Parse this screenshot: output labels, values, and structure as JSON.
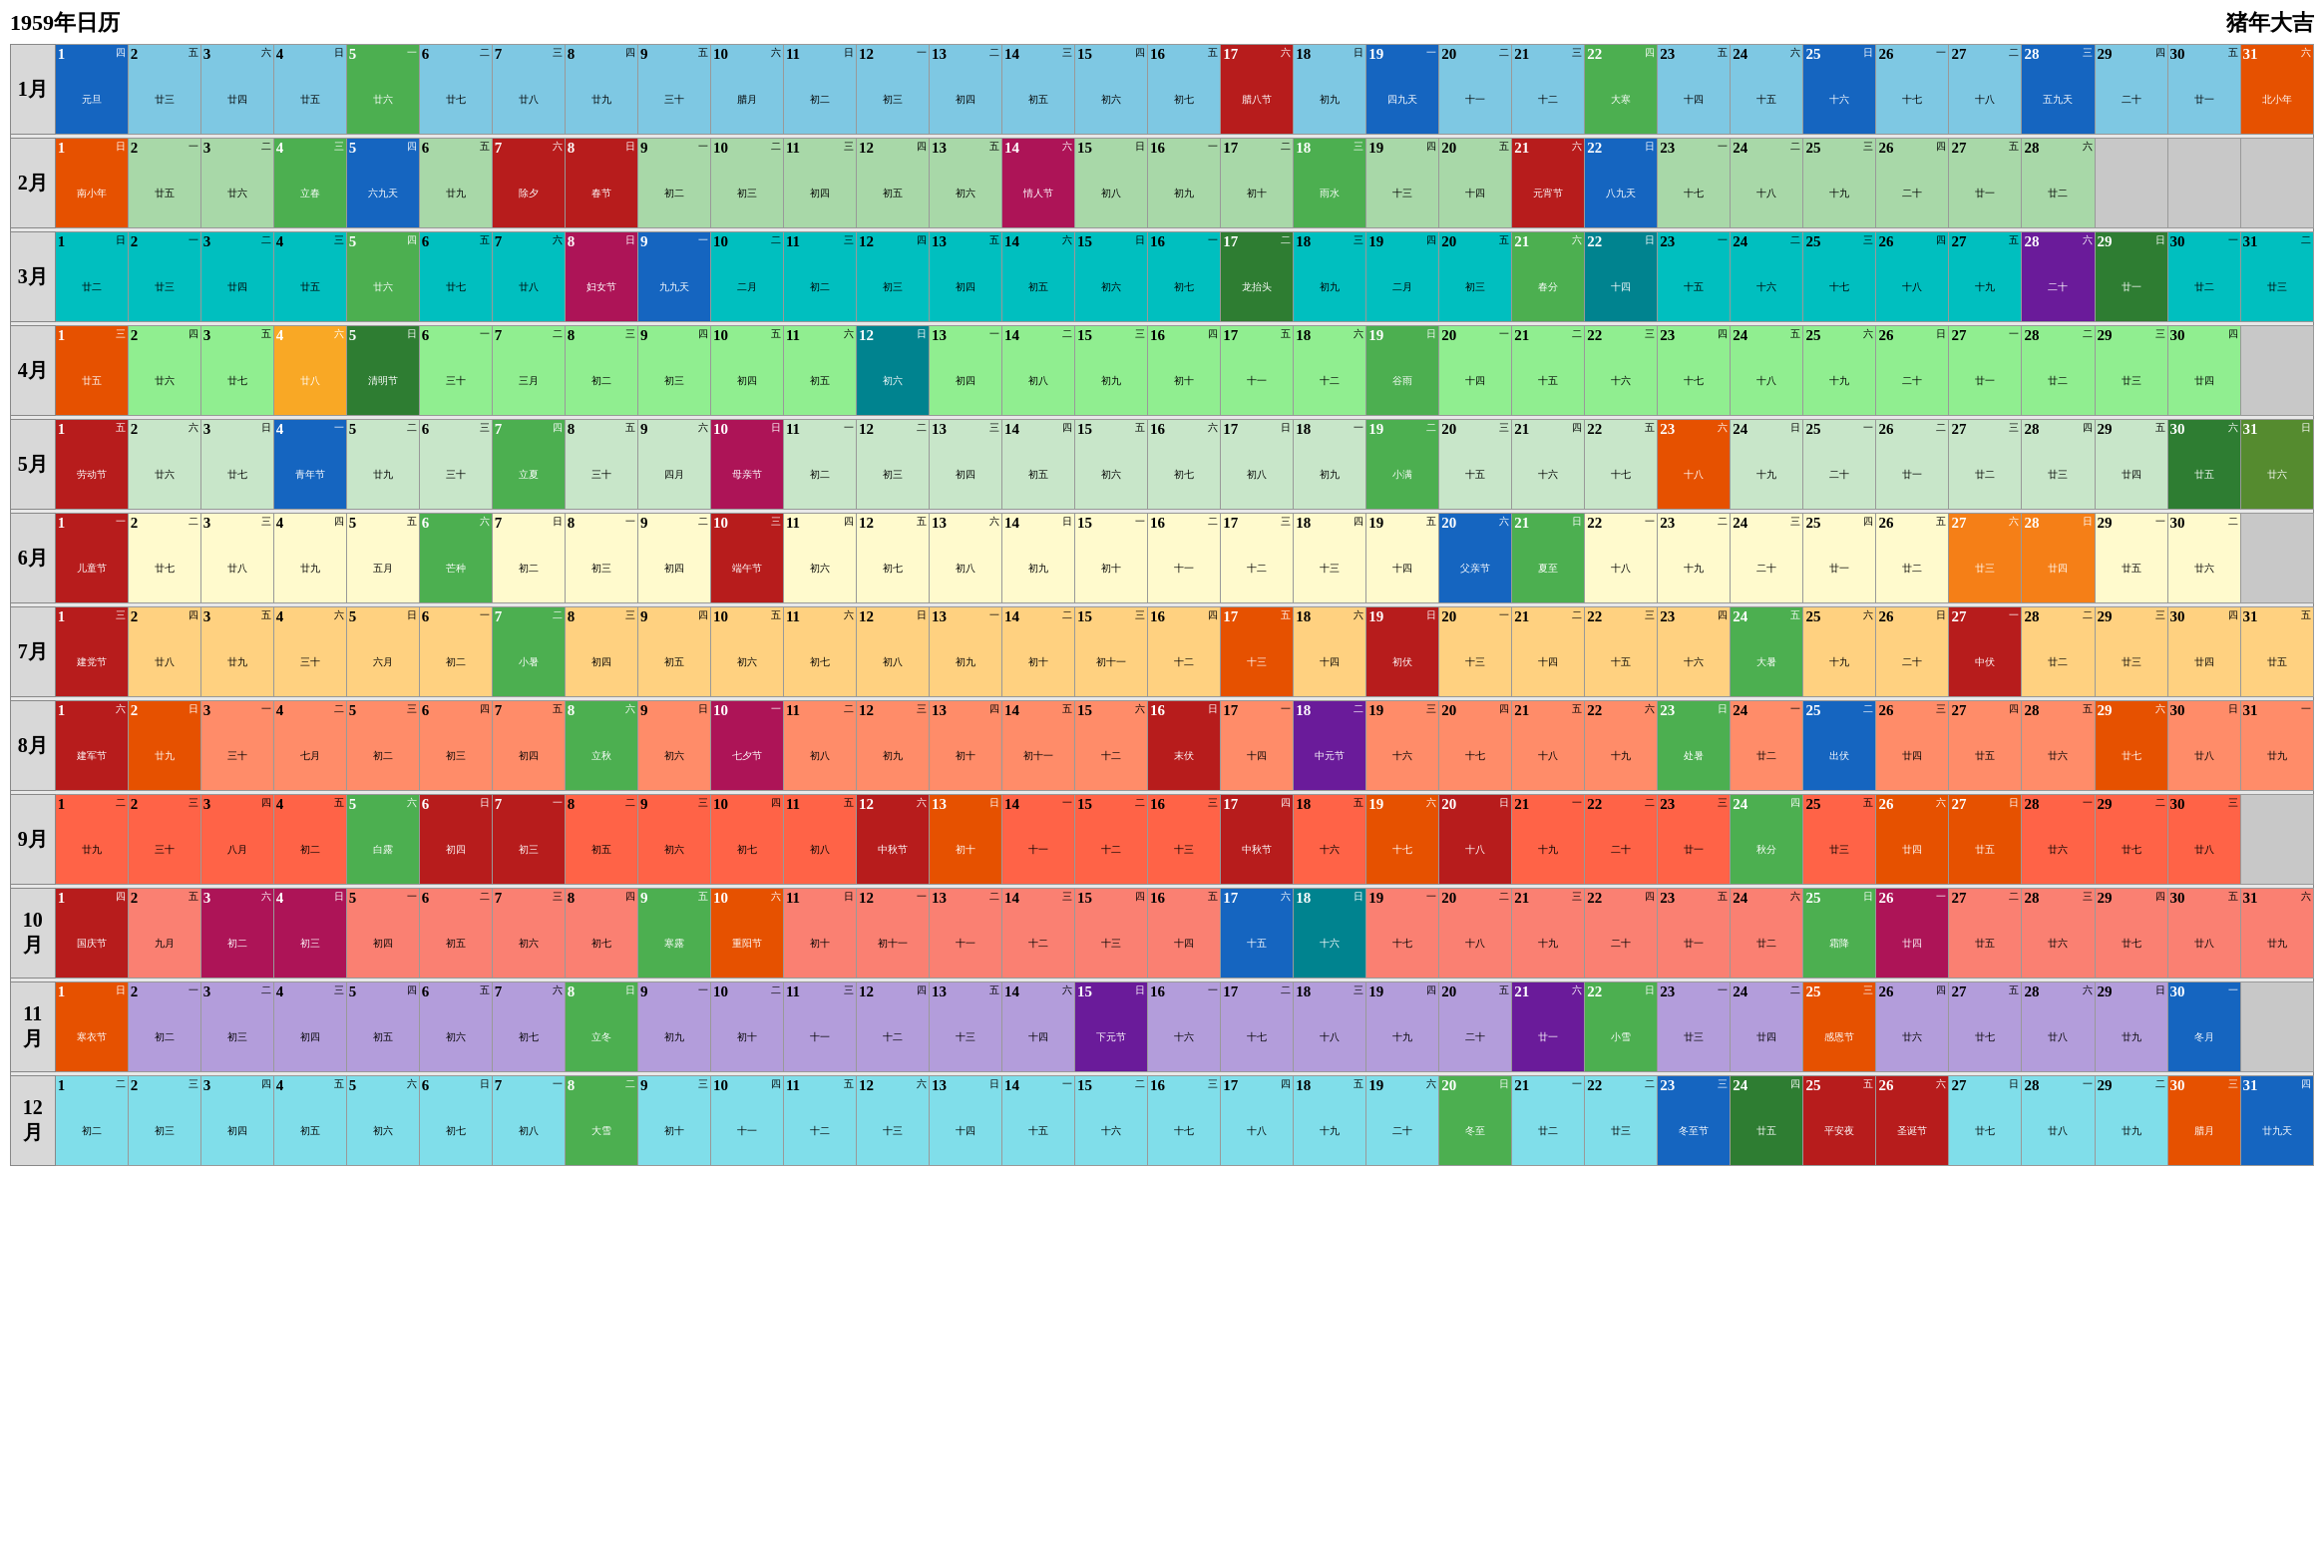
{
  "header": {
    "title": "1959年日历",
    "zodiac": "猪年大吉"
  },
  "months": [
    {
      "name": "1月",
      "bg": "m1",
      "days": 31
    },
    {
      "name": "2月",
      "bg": "m2",
      "days": 28
    },
    {
      "name": "3月",
      "bg": "m3",
      "days": 31
    },
    {
      "name": "4月",
      "bg": "m4",
      "days": 30
    },
    {
      "name": "5月",
      "bg": "m5",
      "days": 31
    },
    {
      "name": "6月",
      "bg": "m6",
      "days": 30
    },
    {
      "name": "7月",
      "bg": "m7",
      "days": 31
    },
    {
      "name": "8月",
      "bg": "m8",
      "days": 31
    },
    {
      "name": "9月",
      "bg": "m9",
      "days": 30
    },
    {
      "name": "10月",
      "bg": "m10",
      "days": 31
    },
    {
      "name": "11月",
      "bg": "m11",
      "days": 30
    },
    {
      "name": "12月",
      "bg": "m12",
      "days": 31
    }
  ]
}
